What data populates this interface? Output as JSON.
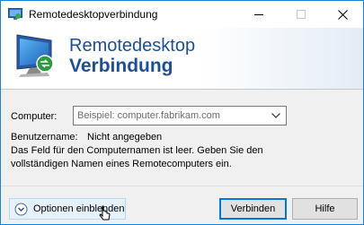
{
  "window": {
    "title": "Remotedesktopverbindung",
    "icon": "remote-desktop-icon"
  },
  "titlebar_buttons": {
    "minimize_icon": "minimize-icon",
    "maximize_icon": "maximize-icon",
    "close_icon": "close-icon"
  },
  "banner": {
    "line1": "Remotedesktop",
    "line2": "Verbindung",
    "icon": "monitor-remote-icon"
  },
  "form": {
    "computer_label": "Computer:",
    "computer_value": "",
    "computer_placeholder": "Beispiel: computer.fabrikam.com",
    "username_label": "Benutzername:",
    "username_value": "Nicht angegeben",
    "info_text": "Das Feld für den Computernamen ist leer. Geben Sie den vollständigen Namen eines Remotecomputers ein."
  },
  "footer": {
    "options_label": "Optionen einblenden",
    "connect_label": "Verbinden",
    "help_label": "Hilfe"
  },
  "colors": {
    "accent": "#0078d7",
    "banner_text": "#1b4f9c",
    "window_border": "#1883d7"
  }
}
